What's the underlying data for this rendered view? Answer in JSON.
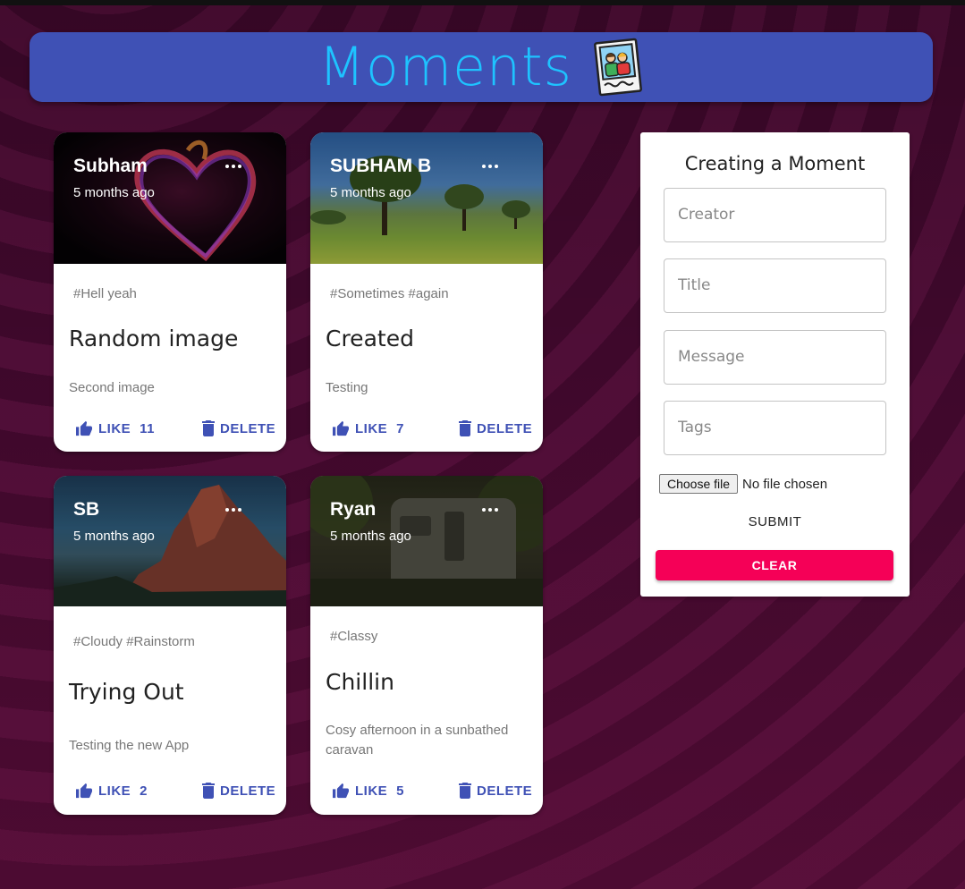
{
  "header": {
    "title": "Moments",
    "logo_icon": "photo-memories-icon",
    "bar_color": "#3f51b5",
    "title_color": "#1ec3ff"
  },
  "posts": [
    {
      "author": "Subham",
      "time": "5 months ago",
      "tags": "#Hell yeah",
      "title": "Random image",
      "message": "Second image",
      "like_label": "LIKE",
      "like_count": "11",
      "delete_label": "DELETE",
      "image": "neon-heart-smoke"
    },
    {
      "author": "SUBHAM B",
      "time": "5 months ago",
      "tags": "#Sometimes #again",
      "title": "Created",
      "message": "Testing",
      "like_label": "LIKE",
      "like_count": "7",
      "delete_label": "DELETE",
      "image": "tree-meadow"
    },
    {
      "author": "SB",
      "time": "5 months ago",
      "tags": "#Cloudy #Rainstorm",
      "title": "Trying Out",
      "message": "Testing the new App",
      "like_label": "LIKE",
      "like_count": "2",
      "delete_label": "DELETE",
      "image": "red-rock-formation"
    },
    {
      "author": "Ryan",
      "time": "5 months ago",
      "tags": "#Classy",
      "title": "Chillin",
      "message": "Cosy afternoon in a sunbathed caravan",
      "like_label": "LIKE",
      "like_count": "5",
      "delete_label": "DELETE",
      "image": "caravan-in-forest"
    }
  ],
  "form": {
    "title": "Creating a Moment",
    "creator_placeholder": "Creator",
    "title_placeholder": "Title",
    "message_placeholder": "Message",
    "tags_placeholder": "Tags",
    "file_button": "Choose file",
    "file_status": "No file chosen",
    "submit_label": "SUBMIT",
    "clear_label": "CLEAR",
    "clear_color": "#f50057"
  },
  "accent_color": "#3f51b5"
}
